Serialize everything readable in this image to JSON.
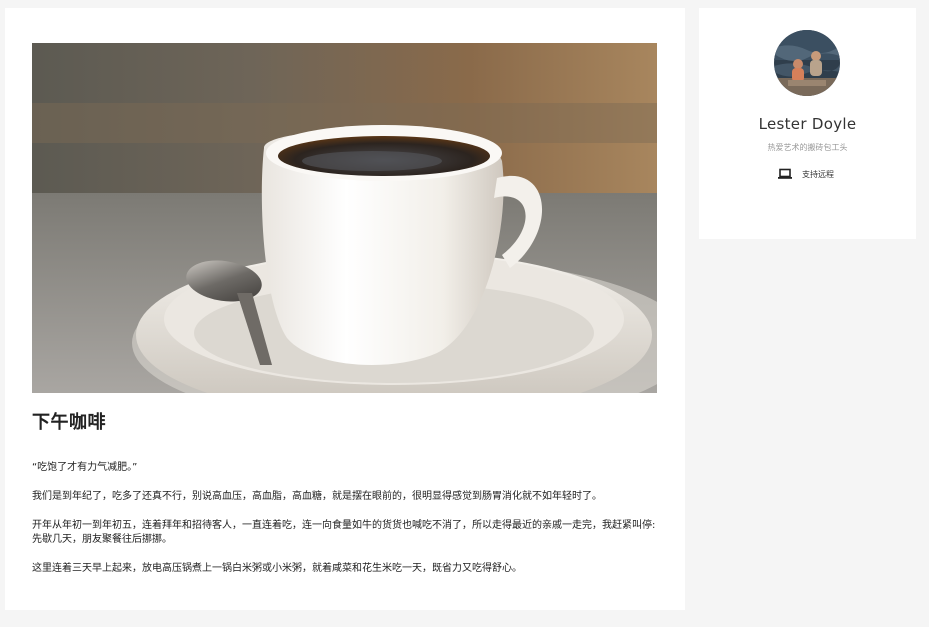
{
  "post": {
    "image_alt": "white coffee cup on saucer with spoon",
    "title": "下午咖啡",
    "paragraphs": [
      "“吃饱了才有力气减肥。”",
      "我们是到年纪了，吃多了还真不行，别说高血压，高血脂，高血糖，就是摆在眼前的，很明显得感觉到肠胃消化就不如年轻时了。",
      "开年从年初一到年初五，连着拜年和招待客人，一直连着吃，连一向食量如牛的货货也喊吃不消了，所以走得最近的亲戚一走完，我赶紧叫停:先歇几天，朋友聚餐往后挪挪。",
      "这里连着三天早上起来，放电高压锅煮上一锅白米粥或小米粥，就着咸菜和花生米吃一天，既省力又吃得舒心。"
    ]
  },
  "profile": {
    "name": "Lester Doyle",
    "bio": "热爱艺术的搬砖包工头",
    "status_icon": "laptop-icon",
    "status_text": "支持远程"
  },
  "colors": {
    "page_background": "#f5f5f5",
    "card_background": "#ffffff",
    "text_primary": "#222222",
    "text_muted": "#999999"
  }
}
